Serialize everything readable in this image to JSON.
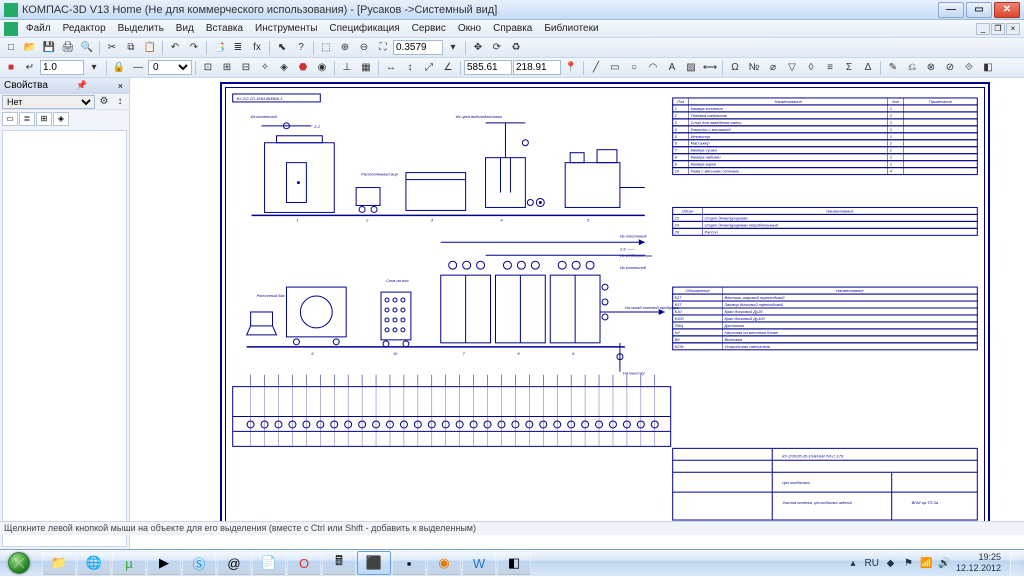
{
  "title": "КОМПАС-3D V13 Home (Не для коммерческого использования) - [Русаков ->Системный вид]",
  "menu": [
    "Файл",
    "Редактор",
    "Выделить",
    "Вид",
    "Вставка",
    "Инструменты",
    "Спецификация",
    "Сервис",
    "Окно",
    "Справка",
    "Библиотеки"
  ],
  "toolbar2": {
    "scale": "1.0",
    "stepval": "0"
  },
  "toolbar_readouts": {
    "zoom": "0.3579",
    "x": "585.61",
    "y": "218.91"
  },
  "panel": {
    "title": "Свойства",
    "combo": "Нет"
  },
  "hint": "Щелкните левой кнопкой мыши на объекте для его выделения (вместе с Ctrl или Shift - добавить к выделенным)",
  "drawing": {
    "code": "КУ-2/2-1Л-1/НИ-ВИ/ВШ-1",
    "labels": {
      "k1": "Из котельной",
      "k2": "Растопленный жир",
      "k3": "Из цеха водоподготовки",
      "r1": "Из отопления",
      "r2": "2,5 ——",
      "r3": "Из кондиционера",
      "r4": "Из котельной",
      "r5": "Рассолный бак",
      "r6": "Слив на пол",
      "r7": "На склад готовой продукции",
      "r8": "На очистку"
    },
    "table_main": {
      "headers": [
        "Поз",
        "Наименование",
        "Кол",
        "Примечание"
      ],
      "rows": [
        [
          "1",
          "Камера копчения",
          "1",
          ""
        ],
        [
          "2",
          "Тележка напольная",
          "2",
          ""
        ],
        [
          "3",
          "Стол для наведения смеси",
          "1",
          ""
        ],
        [
          "4",
          "Емкость с мешалкой",
          "1",
          ""
        ],
        [
          "5",
          "Инъектор",
          "1",
          ""
        ],
        [
          "6",
          "Массажер",
          "1",
          ""
        ],
        [
          "7",
          "Камера сушки",
          "1",
          ""
        ],
        [
          "8",
          "Камера набивки",
          "1",
          ""
        ],
        [
          "9",
          "Камера варки",
          "1",
          ""
        ],
        [
          "10",
          "Рама с мясными сетками",
          "4",
          ""
        ]
      ]
    },
    "table_lines": {
      "headers": [
        "Обозн",
        "Наименование"
      ],
      "rows": [
        [
          "22",
          "Спирт денатурирован"
        ],
        [
          "23",
          "Спирт денатурирован отработанный"
        ],
        [
          "26",
          "Рассол"
        ]
      ]
    },
    "table_symbols": {
      "headers": [
        "Обозначение",
        "Наименование"
      ],
      "rows": [
        [
          "К27",
          "Вентиль-шаровой трехходовой"
        ],
        [
          "К37",
          "Затвор дисковый трехходовой"
        ],
        [
          "К10",
          "Кран дисковый Ду25"
        ],
        [
          "К100",
          "Кран дисковый Ду100"
        ],
        [
          "ПИЦ",
          "Датчиком"
        ],
        [
          "Н2",
          "Насосная на местном блоке"
        ],
        [
          "ВК",
          "Вытяжка"
        ],
        [
          "К27в",
          "Устройство смесителя"
        ]
      ]
    },
    "title_block": {
      "doc": "КУ-2/20/26-26-1/НИ-БИ-ТИ-С-179",
      "row1": "Цех колбасных",
      "row2": "Участок копчения, цех колбасных изделий",
      "org": "ВГАУ гр.ТЛ-3а"
    }
  },
  "clock": {
    "time": "19:25",
    "date": "12.12.2012"
  },
  "tray": {
    "lang": "RU"
  }
}
